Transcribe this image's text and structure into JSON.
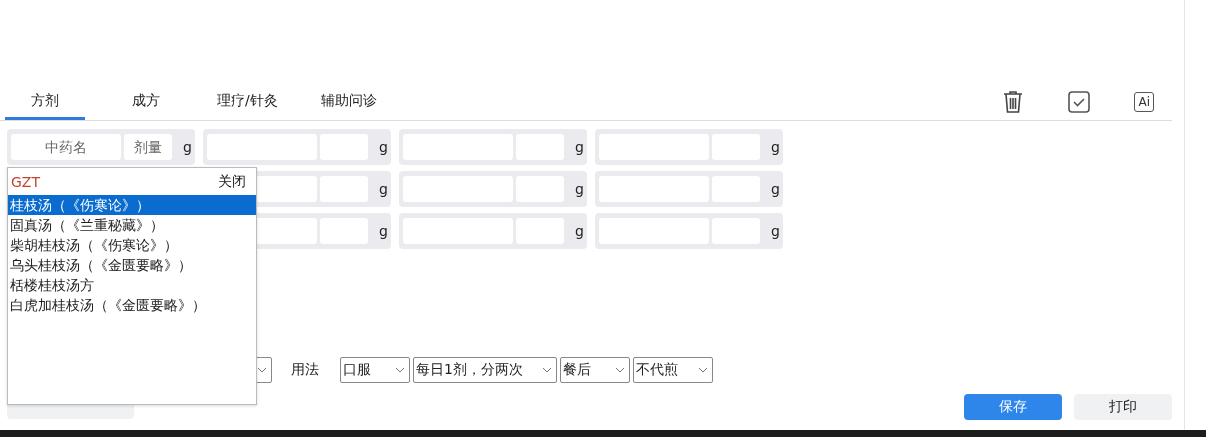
{
  "tabs": [
    {
      "label": "方剂",
      "selected": true
    },
    {
      "label": "成方",
      "selected": false
    },
    {
      "label": "理疗/针灸",
      "selected": false
    },
    {
      "label": "辅助问诊",
      "selected": false
    }
  ],
  "ai_button": {
    "label": "Ai"
  },
  "herb_grid": [
    [
      {
        "name_placeholder": "中药名",
        "dose_placeholder": "剂量",
        "unit": "g"
      },
      {
        "unit": "g"
      },
      {
        "unit": "g"
      },
      {
        "unit": "g"
      }
    ],
    [
      {
        "unit": "g"
      },
      {
        "unit": "g"
      },
      {
        "unit": "g"
      }
    ],
    [
      {
        "unit": "g"
      },
      {
        "unit": "g"
      },
      {
        "unit": "g"
      }
    ]
  ],
  "usage": {
    "label": "用法",
    "selects": [
      {
        "value": "口服"
      },
      {
        "value": "每日1剂，分两次"
      },
      {
        "value": "餐后"
      },
      {
        "value": "不代煎"
      }
    ]
  },
  "actions": [
    {
      "label": "保存",
      "kind": "primary"
    },
    {
      "label": "打印",
      "kind": "secondary"
    }
  ],
  "suggestions": {
    "query": "GZT",
    "close": "关闭",
    "items": [
      {
        "label": "桂枝汤（《伤寒论》）",
        "selected": true
      },
      {
        "label": "固真汤（《兰重秘藏》）",
        "selected": false
      },
      {
        "label": "柴胡桂枝汤（《伤寒论》）",
        "selected": false
      },
      {
        "label": "乌头桂枝汤（《金匮要略》）",
        "selected": false
      },
      {
        "label": "栝楼桂枝汤方",
        "selected": false
      },
      {
        "label": "白虎加桂枝汤（《金匮要略》）",
        "selected": false
      }
    ]
  }
}
